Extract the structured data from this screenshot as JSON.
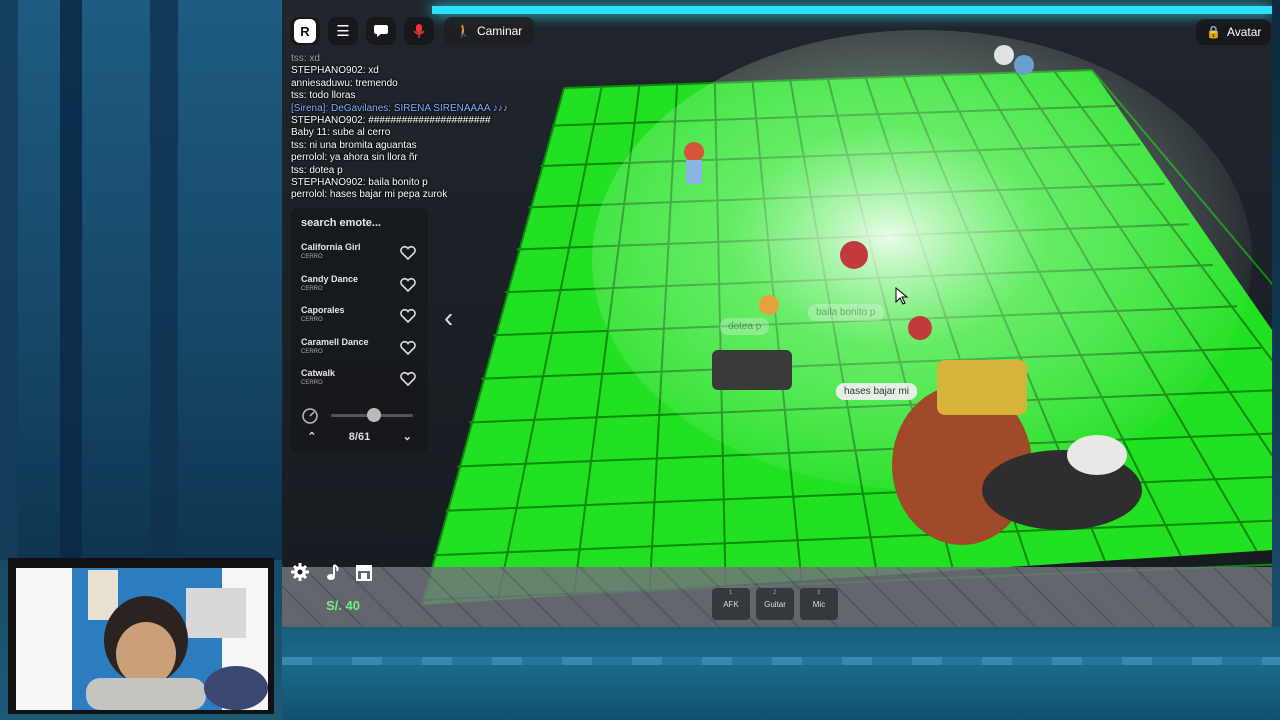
{
  "topbar": {
    "logo": "R",
    "walk_label": "Caminar",
    "avatar_label": "Avatar",
    "icons": [
      "roblox-logo-icon",
      "menu-icon",
      "chat-icon",
      "mic-icon",
      "walk-icon"
    ]
  },
  "chat": {
    "lines": [
      {
        "text": "tss: xd",
        "style": "dim"
      },
      {
        "text": "STEPHANO902: xd",
        "style": ""
      },
      {
        "text": "anniesaduwu: tremendo",
        "style": ""
      },
      {
        "text": "tss: todo lloras",
        "style": ""
      },
      {
        "text": "[Sirena]: DeGavilanes: SIRENA SIRENAAAA ♪♪♪",
        "style": "blue"
      },
      {
        "text": "STEPHANO902: ######################",
        "style": ""
      },
      {
        "text": "Baby 11: sube al cerro",
        "style": ""
      },
      {
        "text": "tss: ni una bromita aguantas",
        "style": ""
      },
      {
        "text": "perrolol: ya ahora sin llora ñr",
        "style": ""
      },
      {
        "text": "tss: dotea p",
        "style": ""
      },
      {
        "text": "STEPHANO902: baila bonito p",
        "style": ""
      },
      {
        "text": "perrolol: hases bajar mi pepa zurok",
        "style": ""
      }
    ]
  },
  "emotes": {
    "search_placeholder": "search emote...",
    "items": [
      {
        "name": "California Girl",
        "tag": "CERRO"
      },
      {
        "name": "Candy Dance",
        "tag": "CERRO"
      },
      {
        "name": "Caporales",
        "tag": "CERRO"
      },
      {
        "name": "Caramell Dance",
        "tag": "CERRO"
      },
      {
        "name": "Catwalk",
        "tag": "CERRO"
      }
    ],
    "page": "8/61",
    "speed_value": 0.5
  },
  "hud": {
    "money": "S/. 40",
    "hotbar": [
      {
        "num": "1",
        "label": "AFK"
      },
      {
        "num": "2",
        "label": "Guitar"
      },
      {
        "num": "3",
        "label": "Mic"
      }
    ]
  },
  "bubbles": {
    "b1": "dotea p",
    "b2": "baila bonito p",
    "b3": "hases bajar mi"
  },
  "colors": {
    "floor": "#22e022",
    "floor_dark": "#14b814",
    "money": "#6ff07f",
    "top_glow": "#2ee0ff"
  }
}
